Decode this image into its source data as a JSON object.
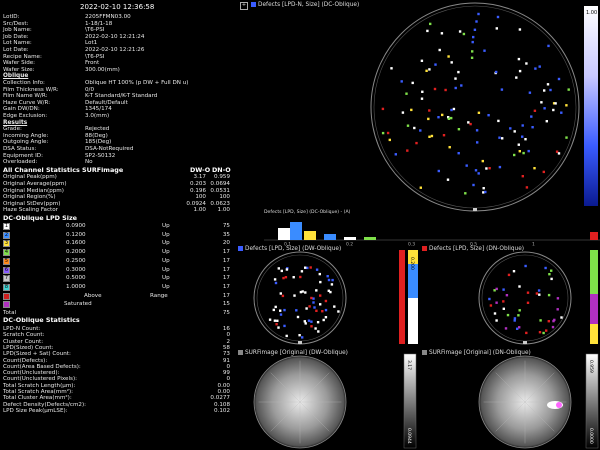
{
  "timestamp": "2022-02-10 12:36:58",
  "info": [
    {
      "k": "LotID:",
      "v": "2205FFMN03.00"
    },
    {
      "k": "Src/Dest:",
      "v": "1-18/1-18"
    },
    {
      "k": "Job Name:",
      "v": "\\T6-PSI"
    },
    {
      "k": "Job Date:",
      "v": "2022-02-10 12:21:24"
    },
    {
      "k": "Lot Name:",
      "v": "Lot1"
    },
    {
      "k": "Lot Date:",
      "v": "2022-02-10 12:21:26"
    },
    {
      "k": "Recipe Name:",
      "v": "\\T6-PSI"
    },
    {
      "k": "Wafer Side:",
      "v": "Front"
    },
    {
      "k": "Wafer Size:",
      "v": "300.00(mm)"
    }
  ],
  "oblique_label": "Oblique",
  "oblique": [
    {
      "k": "Collection Info:",
      "v": "Oblique HT 100% (p DW + Full DN u)"
    },
    {
      "k": "Film Thickness W/R:",
      "v": "0/0"
    },
    {
      "k": "Film Name W/R:",
      "v": "K-T Standard/K-T Standard"
    },
    {
      "k": "Haze Curve W/R:",
      "v": "Default/Default"
    },
    {
      "k": "Gain DW/DN:",
      "v": "1345/174"
    },
    {
      "k": "Edge Exclusion:",
      "v": "3.0(mm)"
    }
  ],
  "results_label": "Results",
  "results": [
    {
      "k": "Grade:",
      "v": "Rejected"
    },
    {
      "k": "Incoming Angle:",
      "v": "88(Deg)"
    },
    {
      "k": "Outgoing Angle:",
      "v": "185(Deg)"
    },
    {
      "k": "DSA Status:",
      "v": "DSA-NotRequired"
    },
    {
      "k": "Equipment ID:",
      "v": "SP2-S0132"
    },
    {
      "k": "Overloaded:",
      "v": "No"
    }
  ],
  "stats_title": "All Channel Statistics SURFimage",
  "stats_cols": [
    "DW-O",
    "DN-O"
  ],
  "stats": [
    {
      "k": "Original Peak(ppm)",
      "a": "3.17",
      "b": "0.959"
    },
    {
      "k": "Original Average(ppm)",
      "a": "0.203",
      "b": "0.0694"
    },
    {
      "k": "Original Median(ppm)",
      "a": "0.196",
      "b": "0.0531"
    },
    {
      "k": "Original Region(%)",
      "a": "100",
      "b": "100"
    },
    {
      "k": "Original StDev(ppm)",
      "a": "0.0924",
      "b": "0.0623"
    },
    {
      "k": "Haze Scaling Factor",
      "a": "1.00",
      "b": "1.00"
    }
  ],
  "lpd_title": "DC-Oblique LPD Size",
  "lpd": [
    {
      "n": "1",
      "size": "0.0900",
      "dir": "Up",
      "count": "75",
      "color": "#ffffff"
    },
    {
      "n": "2",
      "size": "0.1200",
      "dir": "Up",
      "count": "35",
      "color": "#3a8cff"
    },
    {
      "n": "3",
      "size": "0.1600",
      "dir": "Up",
      "count": "20",
      "color": "#ffe13a"
    },
    {
      "n": "4",
      "size": "0.2000",
      "dir": "Up",
      "count": "17",
      "color": "#7fe04a"
    },
    {
      "n": "5",
      "size": "0.2500",
      "dir": "Up",
      "count": "17",
      "color": "#ff8a1a"
    },
    {
      "n": "6",
      "size": "0.3000",
      "dir": "Up",
      "count": "17",
      "color": "#8a5cff"
    },
    {
      "n": "7",
      "size": "0.5000",
      "dir": "Up",
      "count": "17",
      "color": "#c8c8c8"
    },
    {
      "n": "8",
      "size": "1.0000",
      "dir": "Up",
      "count": "17",
      "color": "#40d0d0"
    }
  ],
  "above": {
    "label": "Above",
    "mid": "Range",
    "count": "17",
    "color": "#d02020"
  },
  "saturated": {
    "label": "Saturated",
    "count": "15",
    "color": "#b030c0"
  },
  "total": {
    "label": "Total",
    "count": "75"
  },
  "dc_title": "DC-Oblique Statistics",
  "dc_stats": [
    {
      "k": "LPD-N Count:",
      "v": "16"
    },
    {
      "k": "Scratch Count:",
      "v": "0"
    },
    {
      "k": "Cluster Count:",
      "v": "2"
    },
    {
      "k": "LPD(Sized) Count:",
      "v": "58"
    },
    {
      "k": "LPD(Sized + Sat) Count:",
      "v": "73"
    },
    {
      "k": "Count(Defects):",
      "v": "91"
    },
    {
      "k": "Count(Area Based Defects):",
      "v": "0"
    },
    {
      "k": "Count(Unclustered):",
      "v": "99"
    },
    {
      "k": "Count(Unclustered Pixels):",
      "v": "0"
    },
    {
      "k": "Total Scratch Length(µm):",
      "v": "0.00"
    },
    {
      "k": "Total Scratch Area(mm²):",
      "v": "0.00"
    },
    {
      "k": "Total Cluster Area(mm²):",
      "v": "0.0277"
    },
    {
      "k": "Defect Density(Defects/cm2):",
      "v": "0.108"
    },
    {
      "k": "LPD Size Peak(µmLSE):",
      "v": "0.102"
    }
  ],
  "pane_main": "Defects [LPD-N, Size] (DC-Oblique)",
  "histo_title": "Defects [LPD, Size] (DC-Oblique) - (A)",
  "histo_ticks": [
    "0.1",
    "0.2",
    "0.3",
    "0.5",
    "1"
  ],
  "histo_values": [
    4,
    6,
    3,
    2,
    1,
    1
  ],
  "pane_dw": "Defects [LPD, Size] (DW-Oblique)",
  "pane_dn": "Defects [LPD, Size] (DN-Oblique)",
  "pane_sdw": "SURFimage [Original] (DW-Oblique)",
  "pane_sdn": "SURFimage [Original] (DN-Oblique)",
  "scale_main_top": "1.00",
  "scale_dw_top": "0.200",
  "scale_sdw_top": "3.17",
  "scale_sdw_bot": "0.0944",
  "scale_sdn_top": "0.959",
  "scale_sdn_bot": "0.0000"
}
